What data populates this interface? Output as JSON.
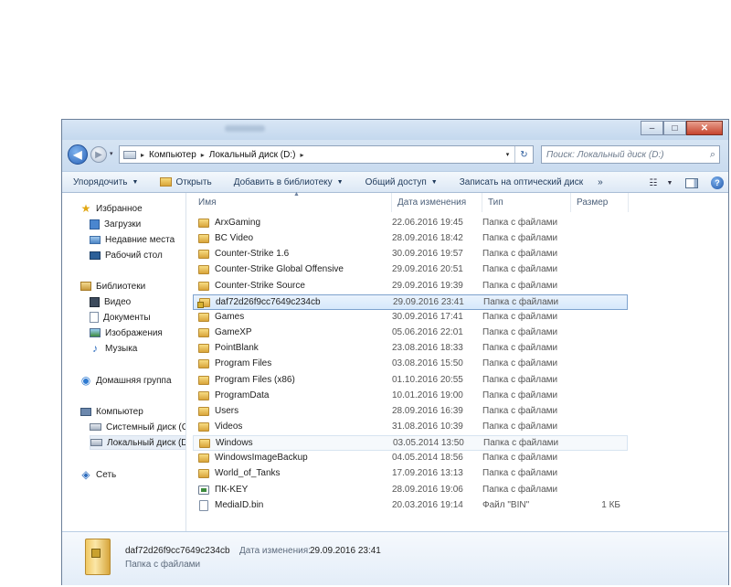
{
  "window": {
    "caption_buttons": {
      "minimize": "–",
      "maximize": "□",
      "close": "✕"
    }
  },
  "navbar": {
    "back": "◀",
    "forward": "▶",
    "dropdown": "▾",
    "breadcrumbs": [
      "Компьютер",
      "Локальный диск (D:)"
    ],
    "search_placeholder": "Поиск: Локальный диск (D:)",
    "search_icon": "search-icon",
    "refresh_icon": "↻"
  },
  "toolbar": {
    "organize": "Упорядочить",
    "open": "Открыть",
    "add_to_library": "Добавить в библиотеку",
    "share": "Общий доступ",
    "burn": "Записать на оптический диск",
    "more": "»",
    "view_icon": "☷",
    "help": "?"
  },
  "sidebar": {
    "favorites": "Избранное",
    "downloads": "Загрузки",
    "recent": "Недавние места",
    "desktop": "Рабочий стол",
    "libraries": "Библиотеки",
    "video": "Видео",
    "documents": "Документы",
    "images": "Изображения",
    "music": "Музыка",
    "homegroup": "Домашняя группа",
    "computer": "Компьютер",
    "system_disk": "Системный диск (C",
    "local_disk": "Локальный диск (D",
    "network": "Сеть"
  },
  "columns": {
    "name": "Имя",
    "date": "Дата изменения",
    "type": "Тип",
    "size": "Размер"
  },
  "files": [
    {
      "name": "ArxGaming",
      "date": "22.06.2016 19:45",
      "type": "Папка с файлами",
      "size": ""
    },
    {
      "name": "BC Video",
      "date": "28.09.2016 18:42",
      "type": "Папка с файлами",
      "size": ""
    },
    {
      "name": "Counter-Strike 1.6",
      "date": "30.09.2016 19:57",
      "type": "Папка с файлами",
      "size": ""
    },
    {
      "name": "Counter-Strike Global Offensive",
      "date": "29.09.2016 20:51",
      "type": "Папка с файлами",
      "size": ""
    },
    {
      "name": "Counter-Strike Source",
      "date": "29.09.2016 19:39",
      "type": "Папка с файлами",
      "size": ""
    },
    {
      "name": "daf72d26f9cc7649c234cb",
      "date": "29.09.2016 23:41",
      "type": "Папка с файлами",
      "size": ""
    },
    {
      "name": "Games",
      "date": "30.09.2016 17:41",
      "type": "Папка с файлами",
      "size": ""
    },
    {
      "name": "GameXP",
      "date": "05.06.2016 22:01",
      "type": "Папка с файлами",
      "size": ""
    },
    {
      "name": "PointBlank",
      "date": "23.08.2016 18:33",
      "type": "Папка с файлами",
      "size": ""
    },
    {
      "name": "Program Files",
      "date": "03.08.2016 15:50",
      "type": "Папка с файлами",
      "size": ""
    },
    {
      "name": "Program Files (x86)",
      "date": "01.10.2016 20:55",
      "type": "Папка с файлами",
      "size": ""
    },
    {
      "name": "ProgramData",
      "date": "10.01.2016 19:00",
      "type": "Папка с файлами",
      "size": ""
    },
    {
      "name": "Users",
      "date": "28.09.2016 16:39",
      "type": "Папка с файлами",
      "size": ""
    },
    {
      "name": "Videos",
      "date": "31.08.2016 10:39",
      "type": "Папка с файлами",
      "size": ""
    },
    {
      "name": "Windows",
      "date": "03.05.2014 13:50",
      "type": "Папка с файлами",
      "size": ""
    },
    {
      "name": "WindowsImageBackup",
      "date": "04.05.2014 18:56",
      "type": "Папка с файлами",
      "size": ""
    },
    {
      "name": "World_of_Tanks",
      "date": "17.09.2016 13:13",
      "type": "Папка с файлами",
      "size": ""
    },
    {
      "name": "ПК-KEY",
      "date": "28.09.2016 19:06",
      "type": "Папка с файлами",
      "size": ""
    },
    {
      "name": "MediaID.bin",
      "date": "20.03.2016 19:14",
      "type": "Файл \"BIN\"",
      "size": "1 КБ"
    }
  ],
  "details": {
    "name": "daf72d26f9cc7649c234cb",
    "date_label": "Дата изменения:",
    "date": "29.09.2016 23:41",
    "type": "Папка с файлами"
  }
}
